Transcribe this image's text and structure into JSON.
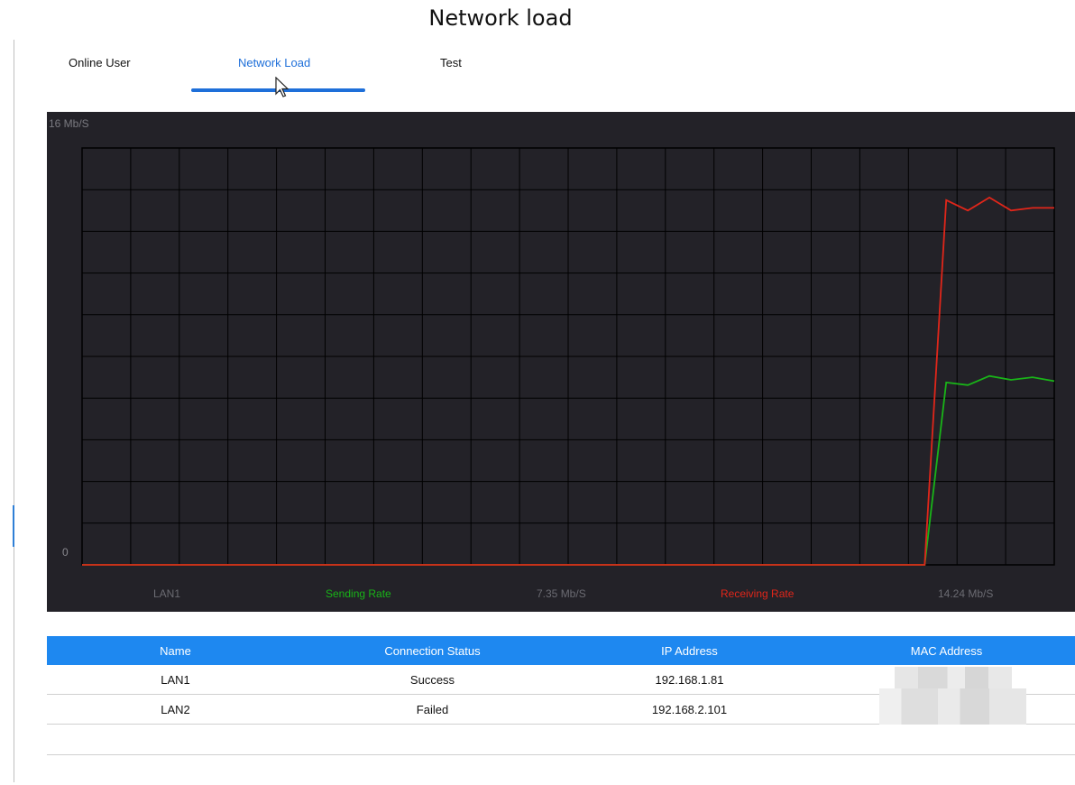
{
  "page": {
    "title": "Network load"
  },
  "tabs": [
    {
      "label": "Online User",
      "active": false
    },
    {
      "label": "Network Load",
      "active": true
    },
    {
      "label": "Test",
      "active": false
    }
  ],
  "colors": {
    "accent": "#1e88f0",
    "sending": "#19b418",
    "receiving": "#e0261a",
    "chart_bg": "#232228",
    "grid": "#000000"
  },
  "chart_data": {
    "type": "line",
    "ylim": [
      0,
      16
    ],
    "y_top_label": "16 Mb/S",
    "y_bottom_label": "0",
    "x_points": 21,
    "series": [
      {
        "name": "Sending Rate",
        "color": "#19b418",
        "values": [
          0,
          0,
          0,
          0,
          0,
          0,
          0,
          0,
          0,
          0,
          0,
          0,
          0,
          0,
          0,
          0,
          0,
          0,
          0,
          0,
          0,
          0,
          0,
          0,
          0,
          0,
          0,
          0,
          0,
          0,
          0,
          0,
          0,
          0,
          0,
          0,
          0,
          0,
          0,
          0,
          7.0,
          6.9,
          7.25,
          7.1,
          7.2,
          7.05
        ]
      },
      {
        "name": "Receiving Rate",
        "color": "#e0261a",
        "values": [
          0,
          0,
          0,
          0,
          0,
          0,
          0,
          0,
          0,
          0,
          0,
          0,
          0,
          0,
          0,
          0,
          0,
          0,
          0,
          0,
          0,
          0,
          0,
          0,
          0,
          0,
          0,
          0,
          0,
          0,
          0,
          0,
          0,
          0,
          0,
          0,
          0,
          0,
          0,
          0,
          14.0,
          13.6,
          14.1,
          13.6,
          13.7,
          13.7
        ]
      }
    ],
    "legend": {
      "interface": "LAN1",
      "sending_label": "Sending Rate",
      "sending_value": "7.35 Mb/S",
      "receiving_label": "Receiving Rate",
      "receiving_value": "14.24 Mb/S"
    }
  },
  "table": {
    "headers": [
      "Name",
      "Connection Status",
      "IP Address",
      "MAC Address"
    ],
    "rows": [
      {
        "name": "LAN1",
        "status": "Success",
        "ip": "192.168.1.81",
        "mac": ""
      },
      {
        "name": "LAN2",
        "status": "Failed",
        "ip": "192.168.2.101",
        "mac": ""
      }
    ]
  }
}
